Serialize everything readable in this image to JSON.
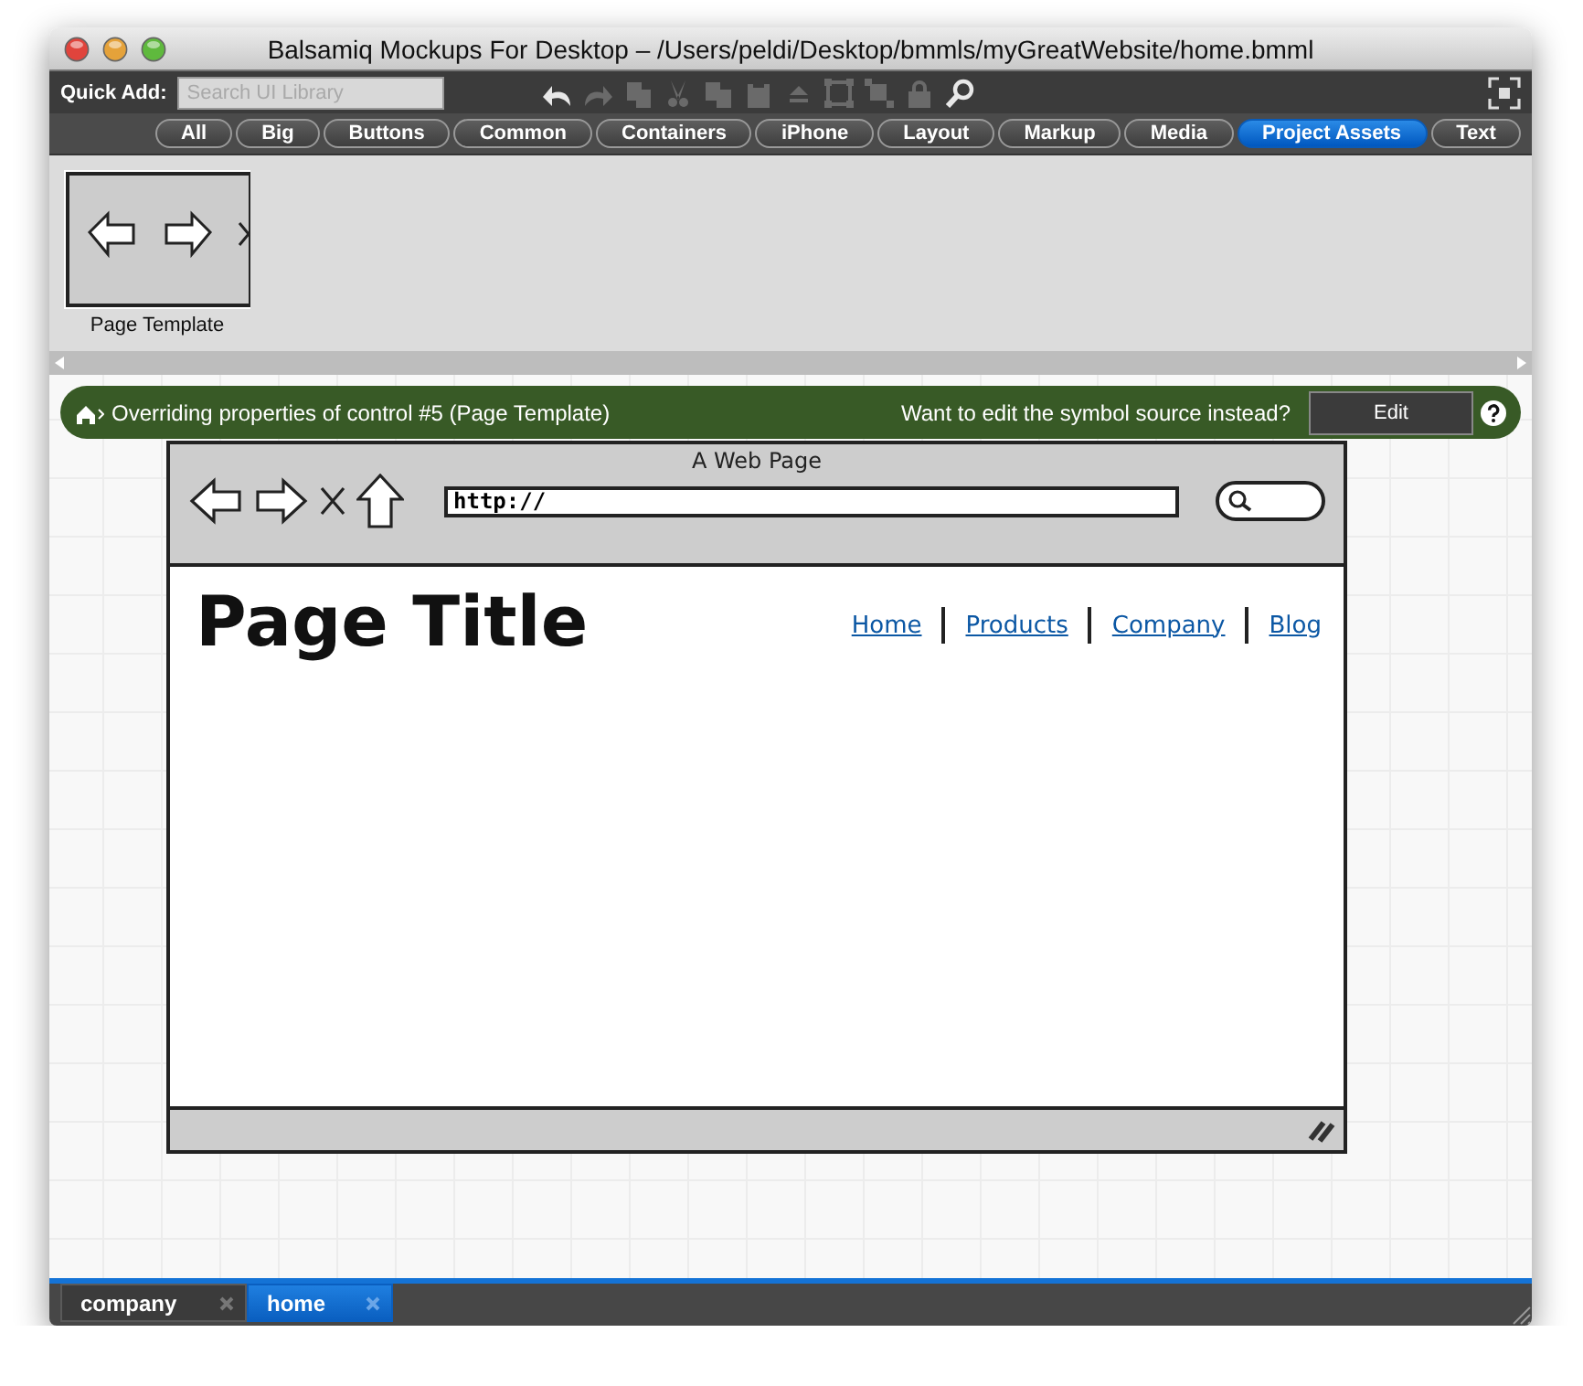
{
  "window": {
    "title": "Balsamiq Mockups For Desktop – /Users/peldi/Desktop/bmmls/myGreatWebsite/home.bmml"
  },
  "toolbar": {
    "quick_add_label": "Quick Add:",
    "search": {
      "placeholder": "Search UI Library"
    },
    "buttons": [
      {
        "kind": "undo",
        "disabled": false
      },
      {
        "kind": "redo",
        "disabled": true
      },
      {
        "kind": "duplicate",
        "disabled": true
      },
      {
        "kind": "cut",
        "disabled": true
      },
      {
        "kind": "copy",
        "disabled": true
      },
      {
        "kind": "paste",
        "disabled": true
      },
      {
        "kind": "front",
        "disabled": true
      },
      {
        "kind": "group",
        "disabled": true
      },
      {
        "kind": "ungroup",
        "disabled": true
      },
      {
        "kind": "lock",
        "disabled": true
      },
      {
        "kind": "search",
        "disabled": false
      }
    ]
  },
  "categories": [
    {
      "label": "All",
      "selected": false
    },
    {
      "label": "Big",
      "selected": false
    },
    {
      "label": "Buttons",
      "selected": false
    },
    {
      "label": "Common",
      "selected": false
    },
    {
      "label": "Containers",
      "selected": false
    },
    {
      "label": "iPhone",
      "selected": false
    },
    {
      "label": "Layout",
      "selected": false
    },
    {
      "label": "Markup",
      "selected": false
    },
    {
      "label": "Media",
      "selected": false
    },
    {
      "label": "Project Assets",
      "selected": true
    },
    {
      "label": "Text",
      "selected": false
    }
  ],
  "assets": [
    {
      "label": "Page Template"
    }
  ],
  "banner": {
    "message": "Overriding properties of control #5 (Page Template)",
    "question": "Want to edit the symbol source instead?",
    "button": "Edit"
  },
  "mockup": {
    "title": "A Web Page",
    "url": "http://",
    "page_title": "Page Title",
    "links": [
      "Home",
      "Products",
      "Company",
      "Blog"
    ]
  },
  "tabs": [
    {
      "label": "company",
      "selected": false
    },
    {
      "label": "home",
      "selected": true
    }
  ]
}
